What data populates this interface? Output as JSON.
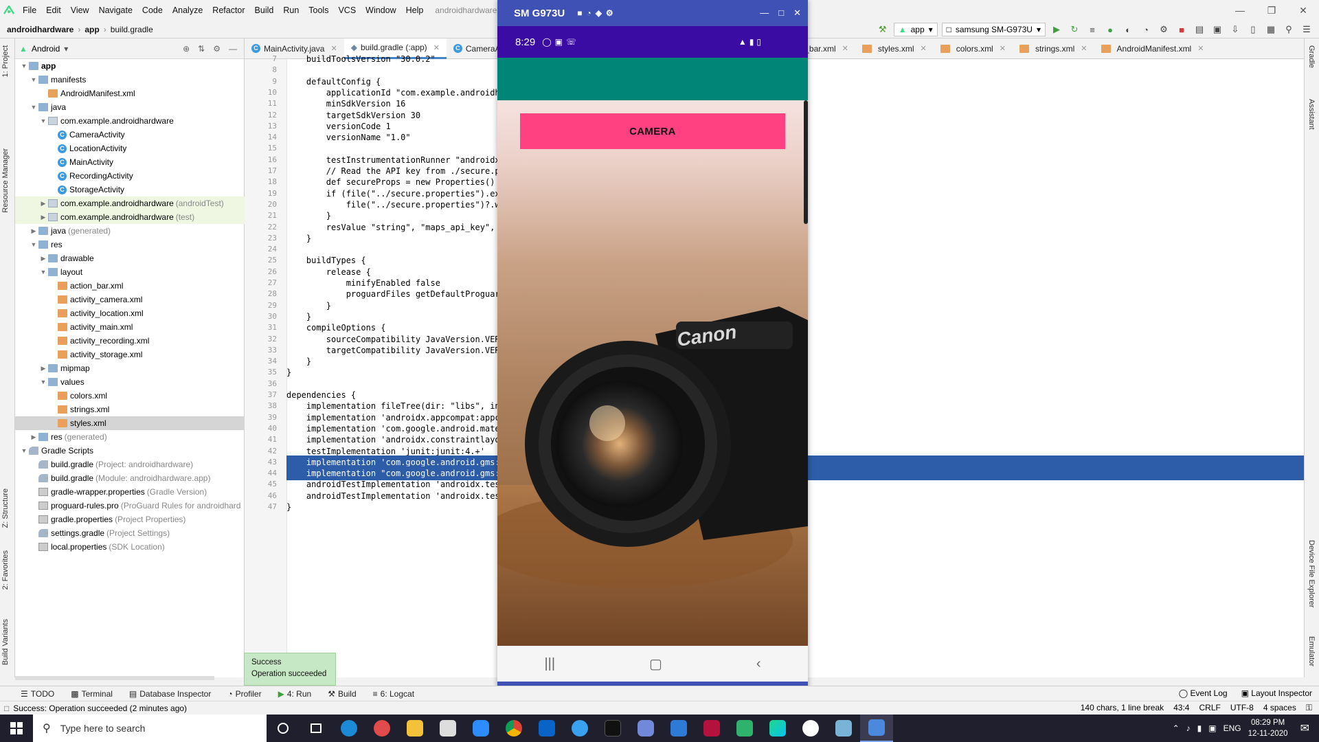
{
  "menubar": {
    "items": [
      "File",
      "Edit",
      "View",
      "Navigate",
      "Code",
      "Analyze",
      "Refactor",
      "Build",
      "Run",
      "Tools",
      "VCS",
      "Window",
      "Help"
    ],
    "window_title": "androidhardware - buil"
  },
  "navbar": {
    "breadcrumbs": [
      "androidhardware",
      "app",
      "build.gradle"
    ],
    "run_config": "app",
    "device": "samsung SM-G973U"
  },
  "project_panel": {
    "view_label": "Android",
    "tree": [
      {
        "label": "app",
        "bold": true
      },
      {
        "label": "manifests"
      },
      {
        "label": "AndroidManifest.xml"
      },
      {
        "label": "java"
      },
      {
        "label": "com.example.androidhardware"
      },
      {
        "label": "CameraActivity"
      },
      {
        "label": "LocationActivity"
      },
      {
        "label": "MainActivity"
      },
      {
        "label": "RecordingActivity"
      },
      {
        "label": "StorageActivity"
      },
      {
        "label": "com.example.androidhardware",
        "suffix": "(androidTest)"
      },
      {
        "label": "com.example.androidhardware",
        "suffix": "(test)"
      },
      {
        "label": "java",
        "suffix": "(generated)"
      },
      {
        "label": "res"
      },
      {
        "label": "drawable"
      },
      {
        "label": "layout"
      },
      {
        "label": "action_bar.xml"
      },
      {
        "label": "activity_camera.xml"
      },
      {
        "label": "activity_location.xml"
      },
      {
        "label": "activity_main.xml"
      },
      {
        "label": "activity_recording.xml"
      },
      {
        "label": "activity_storage.xml"
      },
      {
        "label": "mipmap"
      },
      {
        "label": "values"
      },
      {
        "label": "colors.xml"
      },
      {
        "label": "strings.xml"
      },
      {
        "label": "styles.xml"
      },
      {
        "label": "res",
        "suffix": "(generated)"
      },
      {
        "label": "Gradle Scripts"
      },
      {
        "label": "build.gradle",
        "suffix": "(Project: androidhardware)"
      },
      {
        "label": "build.gradle",
        "suffix": "(Module: androidhardware.app)"
      },
      {
        "label": "gradle-wrapper.properties",
        "suffix": "(Gradle Version)"
      },
      {
        "label": "proguard-rules.pro",
        "suffix": "(ProGuard Rules for androidhard"
      },
      {
        "label": "gradle.properties",
        "suffix": "(Project Properties)"
      },
      {
        "label": "settings.gradle",
        "suffix": "(Project Settings)"
      },
      {
        "label": "local.properties",
        "suffix": "(SDK Location)"
      }
    ]
  },
  "editor_tabs": [
    "MainActivity.java",
    "build.gradle (:app)",
    "CameraAc",
    "n_bar.xml",
    "styles.xml",
    "colors.xml",
    "strings.xml",
    "AndroidManifest.xml"
  ],
  "code_lines": [
    {
      "n": "7",
      "t": "    buildToolsVersion \"30.0.2\""
    },
    {
      "n": "8",
      "t": ""
    },
    {
      "n": "9",
      "t": "    defaultConfig {"
    },
    {
      "n": "10",
      "t": "        applicationId \"com.example.androidha"
    },
    {
      "n": "11",
      "t": "        minSdkVersion 16"
    },
    {
      "n": "12",
      "t": "        targetSdkVersion 30"
    },
    {
      "n": "13",
      "t": "        versionCode 1"
    },
    {
      "n": "14",
      "t": "        versionName \"1.0\""
    },
    {
      "n": "15",
      "t": ""
    },
    {
      "n": "16",
      "t": "        testInstrumentationRunner \"androidx."
    },
    {
      "n": "17",
      "t": "        // Read the API key from ./secure.pr"
    },
    {
      "n": "18",
      "t": "        def secureProps = new Properties()"
    },
    {
      "n": "19",
      "t": "        if (file(\"../secure.properties\").exi"
    },
    {
      "n": "20",
      "t": "            file(\"../secure.properties\")?.wi"
    },
    {
      "n": "21",
      "t": "        }"
    },
    {
      "n": "22",
      "t": "        resValue \"string\", \"maps_api_key\", ("
    },
    {
      "n": "23",
      "t": "    }"
    },
    {
      "n": "24",
      "t": ""
    },
    {
      "n": "25",
      "t": "    buildTypes {"
    },
    {
      "n": "26",
      "t": "        release {"
    },
    {
      "n": "27",
      "t": "            minifyEnabled false"
    },
    {
      "n": "28",
      "t": "            proguardFiles getDefaultProguard"
    },
    {
      "n": "29",
      "t": "        }"
    },
    {
      "n": "30",
      "t": "    }"
    },
    {
      "n": "31",
      "t": "    compileOptions {"
    },
    {
      "n": "32",
      "t": "        sourceCompatibility JavaVersion.VERS"
    },
    {
      "n": "33",
      "t": "        targetCompatibility JavaVersion.VERS"
    },
    {
      "n": "34",
      "t": "    }"
    },
    {
      "n": "35",
      "t": "}"
    },
    {
      "n": "36",
      "t": ""
    },
    {
      "n": "37",
      "t": "dependencies {"
    },
    {
      "n": "38",
      "t": "    implementation fileTree(dir: \"libs\", inc"
    },
    {
      "n": "39",
      "t": "    implementation 'androidx.appcompat:appco"
    },
    {
      "n": "40",
      "t": "    implementation 'com.google.android.mater"
    },
    {
      "n": "41",
      "t": "    implementation 'androidx.constraintlayou"
    },
    {
      "n": "42",
      "t": "    testImplementation 'junit:junit:4.+'"
    },
    {
      "n": "43",
      "t": "    implementation 'com.google.android.gms:p"
    },
    {
      "n": "44",
      "t": "    implementation \"com.google.android.gms:p"
    },
    {
      "n": "45",
      "t": "    androidTestImplementation 'androidx.test"
    },
    {
      "n": "46",
      "t": "    androidTestImplementation 'androidx.test"
    },
    {
      "n": "47",
      "t": "}"
    }
  ],
  "emulator": {
    "title": "SM G973U",
    "status_time": "8:29",
    "camera_button": "CAMERA",
    "photo_brand": "Canon"
  },
  "toast": {
    "line1": "Success",
    "line2": "Operation succeeded"
  },
  "bottom_tools": [
    "TODO",
    "Terminal",
    "Database Inspector",
    "Profiler",
    "4: Run",
    "Build",
    "6: Logcat"
  ],
  "bottom_right_tools": [
    "Event Log",
    "Layout Inspector"
  ],
  "status": {
    "message": "Success: Operation succeeded (2 minutes ago)",
    "chars": "140 chars, 1 line break",
    "position": "43:4",
    "line_sep": "CRLF",
    "encoding": "UTF-8",
    "indent": "4 spaces"
  },
  "left_stripe": [
    "1: Project",
    "Resource Manager",
    "Z: Structure",
    "2: Favorites",
    "Build Variants"
  ],
  "right_stripe": [
    "Gradle",
    "Assistant",
    "Device File Explorer",
    "Emulator"
  ],
  "taskbar": {
    "search_placeholder": "Type here to search",
    "lang": "ENG",
    "time": "08:29 PM",
    "date": "12-11-2020"
  }
}
